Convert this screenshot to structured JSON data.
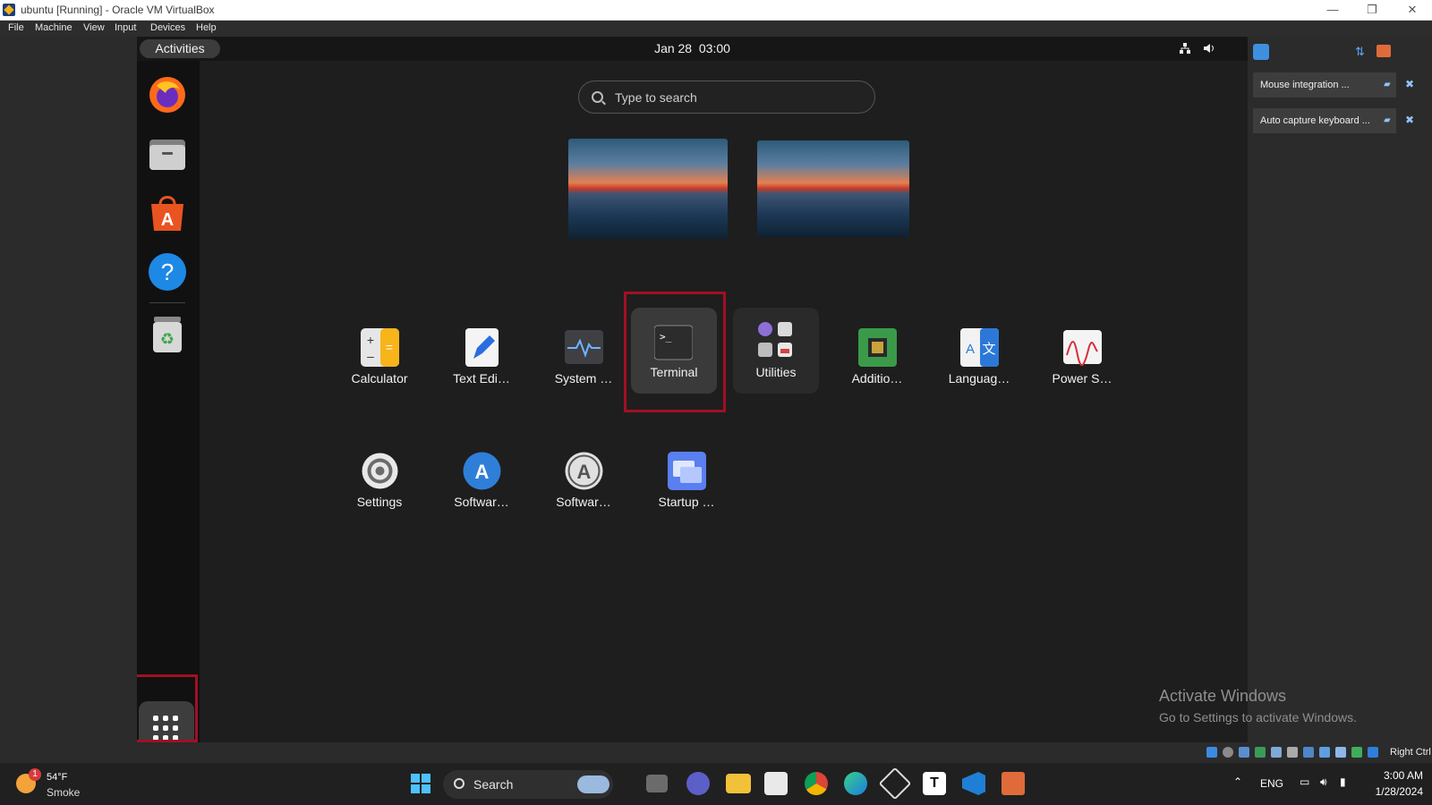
{
  "host_window": {
    "title": "ubuntu [Running] - Oracle VM VirtualBox",
    "controls": {
      "minimize": "—",
      "restore": "❐",
      "close": "✕"
    }
  },
  "host_menu": [
    "File",
    "Machine",
    "View",
    "Input",
    "Devices",
    "Help"
  ],
  "ubuntu": {
    "activities_label": "Activities",
    "clock_date": "Jan 28",
    "clock_time": "03:00",
    "search_placeholder": "Type to search",
    "dock": [
      {
        "name": "firefox-icon"
      },
      {
        "name": "files-icon"
      },
      {
        "name": "app-center-icon"
      },
      {
        "name": "help-icon"
      },
      {
        "name": "trash-icon"
      }
    ],
    "apps": [
      {
        "label": "Calculator",
        "icon": "calculator-icon"
      },
      {
        "label": "Text Edi…",
        "icon": "text-editor-icon"
      },
      {
        "label": "System …",
        "icon": "system-monitor-icon"
      },
      {
        "label": "Terminal",
        "icon": "terminal-icon",
        "selected": true
      },
      {
        "label": "Utilities",
        "icon": "utilities-folder-icon"
      },
      {
        "label": "Additio…",
        "icon": "additional-drivers-icon"
      },
      {
        "label": "Languag…",
        "icon": "language-support-icon"
      },
      {
        "label": "Power S…",
        "icon": "power-statistics-icon"
      },
      {
        "label": "Settings",
        "icon": "settings-icon"
      },
      {
        "label": "Softwar…",
        "icon": "software-updater-icon"
      },
      {
        "label": "Softwar…",
        "icon": "software-properties-icon"
      },
      {
        "label": "Startup …",
        "icon": "startup-applications-icon"
      }
    ]
  },
  "notifications": [
    {
      "text": "Mouse integration ..."
    },
    {
      "text": "Auto capture keyboard ..."
    }
  ],
  "watermark": {
    "title": "Activate Windows",
    "subtitle": "Go to Settings to activate Windows."
  },
  "statusbar": {
    "host_key": "Right Ctrl"
  },
  "taskbar": {
    "weather_temp": "54°F",
    "weather_cond": "Smoke",
    "weather_badge": "1",
    "search_label": "Search",
    "lang": "ENG",
    "time": "3:00 AM",
    "date": "1/28/2024"
  },
  "colors": {
    "highlight_box": "#a30f23",
    "ubuntu_orange": "#e95420"
  }
}
